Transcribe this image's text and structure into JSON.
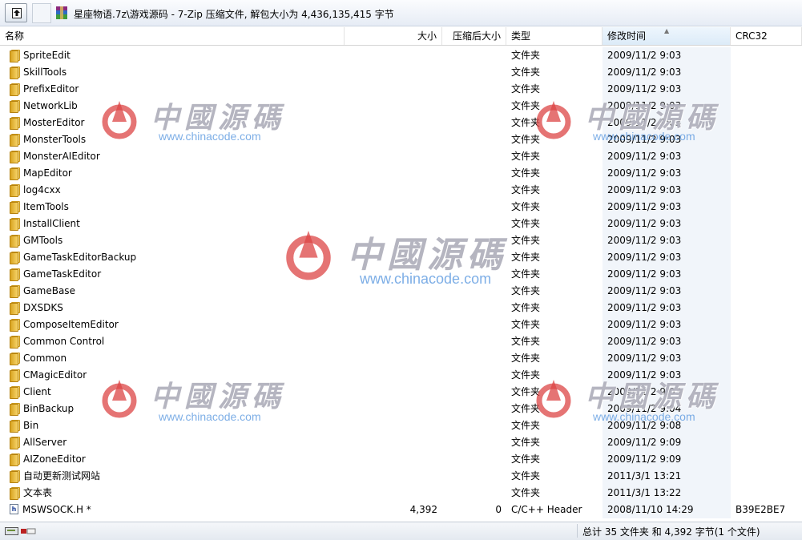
{
  "toolbar": {
    "path": "星座物语.7z\\游戏源码 - 7-Zip 压缩文件, 解包大小为 4,436,135,415 字节"
  },
  "columns": {
    "name": "名称",
    "size": "大小",
    "packed": "压缩后大小",
    "type": "类型",
    "modified": "修改时间",
    "crc": "CRC32"
  },
  "rows": [
    {
      "name": "SpriteEdit",
      "size": "",
      "packed": "",
      "type": "文件夹",
      "modified": "2009/11/2 9:03",
      "crc": "",
      "kind": "folder"
    },
    {
      "name": "SkillTools",
      "size": "",
      "packed": "",
      "type": "文件夹",
      "modified": "2009/11/2 9:03",
      "crc": "",
      "kind": "folder"
    },
    {
      "name": "PrefixEditor",
      "size": "",
      "packed": "",
      "type": "文件夹",
      "modified": "2009/11/2 9:03",
      "crc": "",
      "kind": "folder"
    },
    {
      "name": "NetworkLib",
      "size": "",
      "packed": "",
      "type": "文件夹",
      "modified": "2009/11/2 9:03",
      "crc": "",
      "kind": "folder"
    },
    {
      "name": "MosterEditor",
      "size": "",
      "packed": "",
      "type": "文件夹",
      "modified": "2009/11/2 9:03",
      "crc": "",
      "kind": "folder"
    },
    {
      "name": "MonsterTools",
      "size": "",
      "packed": "",
      "type": "文件夹",
      "modified": "2009/11/2 9:03",
      "crc": "",
      "kind": "folder"
    },
    {
      "name": "MonsterAIEditor",
      "size": "",
      "packed": "",
      "type": "文件夹",
      "modified": "2009/11/2 9:03",
      "crc": "",
      "kind": "folder"
    },
    {
      "name": "MapEditor",
      "size": "",
      "packed": "",
      "type": "文件夹",
      "modified": "2009/11/2 9:03",
      "crc": "",
      "kind": "folder"
    },
    {
      "name": "log4cxx",
      "size": "",
      "packed": "",
      "type": "文件夹",
      "modified": "2009/11/2 9:03",
      "crc": "",
      "kind": "folder"
    },
    {
      "name": "ItemTools",
      "size": "",
      "packed": "",
      "type": "文件夹",
      "modified": "2009/11/2 9:03",
      "crc": "",
      "kind": "folder"
    },
    {
      "name": "InstallClient",
      "size": "",
      "packed": "",
      "type": "文件夹",
      "modified": "2009/11/2 9:03",
      "crc": "",
      "kind": "folder"
    },
    {
      "name": "GMTools",
      "size": "",
      "packed": "",
      "type": "文件夹",
      "modified": "2009/11/2 9:03",
      "crc": "",
      "kind": "folder"
    },
    {
      "name": "GameTaskEditorBackup",
      "size": "",
      "packed": "",
      "type": "文件夹",
      "modified": "2009/11/2 9:03",
      "crc": "",
      "kind": "folder"
    },
    {
      "name": "GameTaskEditor",
      "size": "",
      "packed": "",
      "type": "文件夹",
      "modified": "2009/11/2 9:03",
      "crc": "",
      "kind": "folder"
    },
    {
      "name": "GameBase",
      "size": "",
      "packed": "",
      "type": "文件夹",
      "modified": "2009/11/2 9:03",
      "crc": "",
      "kind": "folder"
    },
    {
      "name": "DXSDKS",
      "size": "",
      "packed": "",
      "type": "文件夹",
      "modified": "2009/11/2 9:03",
      "crc": "",
      "kind": "folder"
    },
    {
      "name": "ComposeItemEditor",
      "size": "",
      "packed": "",
      "type": "文件夹",
      "modified": "2009/11/2 9:03",
      "crc": "",
      "kind": "folder"
    },
    {
      "name": "Common Control",
      "size": "",
      "packed": "",
      "type": "文件夹",
      "modified": "2009/11/2 9:03",
      "crc": "",
      "kind": "folder"
    },
    {
      "name": "Common",
      "size": "",
      "packed": "",
      "type": "文件夹",
      "modified": "2009/11/2 9:03",
      "crc": "",
      "kind": "folder"
    },
    {
      "name": "CMagicEditor",
      "size": "",
      "packed": "",
      "type": "文件夹",
      "modified": "2009/11/2 9:03",
      "crc": "",
      "kind": "folder"
    },
    {
      "name": "Client",
      "size": "",
      "packed": "",
      "type": "文件夹",
      "modified": "2009/11/2 9:03",
      "crc": "",
      "kind": "folder"
    },
    {
      "name": "BinBackup",
      "size": "",
      "packed": "",
      "type": "文件夹",
      "modified": "2009/11/2 9:04",
      "crc": "",
      "kind": "folder"
    },
    {
      "name": "Bin",
      "size": "",
      "packed": "",
      "type": "文件夹",
      "modified": "2009/11/2 9:08",
      "crc": "",
      "kind": "folder"
    },
    {
      "name": "AllServer",
      "size": "",
      "packed": "",
      "type": "文件夹",
      "modified": "2009/11/2 9:09",
      "crc": "",
      "kind": "folder"
    },
    {
      "name": "AIZoneEditor",
      "size": "",
      "packed": "",
      "type": "文件夹",
      "modified": "2009/11/2 9:09",
      "crc": "",
      "kind": "folder"
    },
    {
      "name": "自动更新测试网站",
      "size": "",
      "packed": "",
      "type": "文件夹",
      "modified": "2011/3/1 13:21",
      "crc": "",
      "kind": "folder"
    },
    {
      "name": "文本表",
      "size": "",
      "packed": "",
      "type": "文件夹",
      "modified": "2011/3/1 13:22",
      "crc": "",
      "kind": "folder"
    },
    {
      "name": "MSWSOCK.H *",
      "size": "4,392",
      "packed": "0",
      "type": "C/C++ Header",
      "modified": "2008/11/10 14:29",
      "crc": "B39E2BE7",
      "kind": "file"
    }
  ],
  "status": {
    "summary": "总计 35 文件夹 和 4,392 字节(1 个文件)"
  },
  "watermark": {
    "cn": "中國源碼",
    "url": "www.chinacode.com"
  },
  "icons": {
    "up": "up-folder-icon",
    "archive": "archive-icon",
    "folder": "folder-icon",
    "file": "header-file-icon"
  }
}
